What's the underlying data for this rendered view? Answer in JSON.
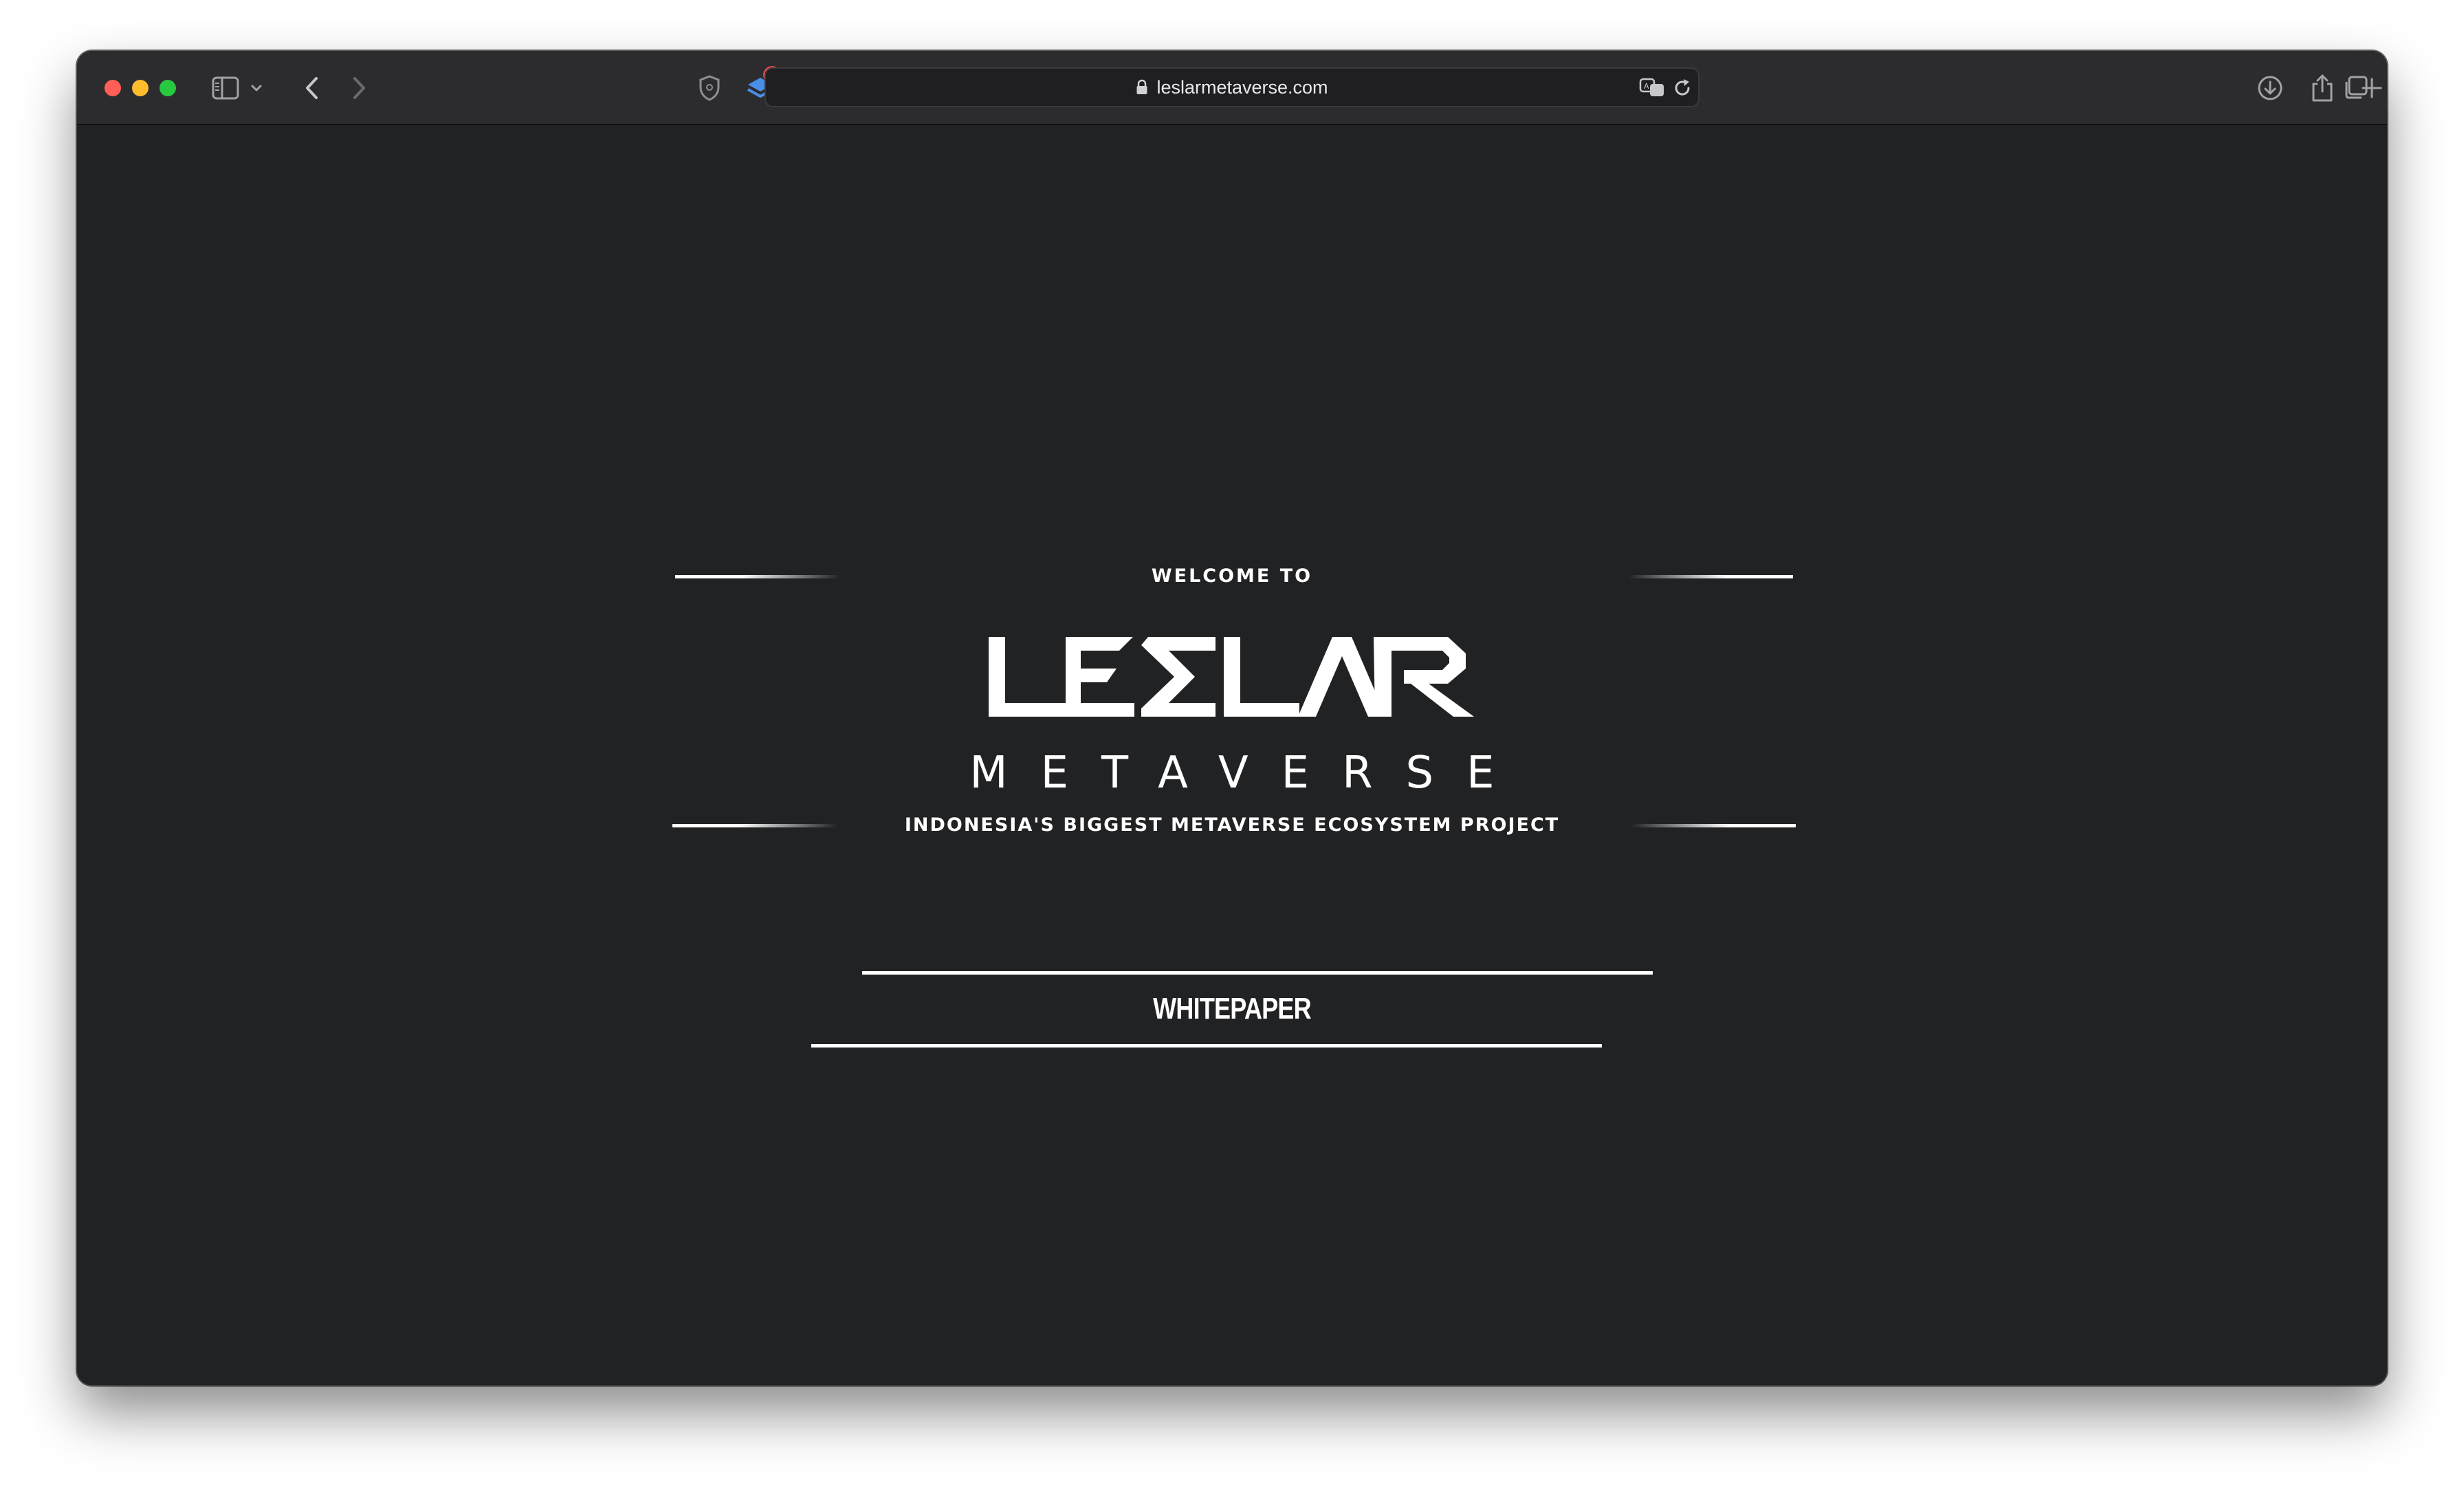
{
  "browser": {
    "url": "leslarmetaverse.com",
    "extension_badge_count": "1"
  },
  "hero": {
    "welcome_text": "WELCOME TO",
    "logo_wordmark": "LESLAR",
    "logo_subtitle": "METAVERSE",
    "tagline": "INDONESIA'S BIGGEST METAVERSE ECOSYSTEM PROJECT",
    "whitepaper_label": "WHITEPAPER"
  },
  "colors": {
    "page_background": "#212224",
    "text": "#ffffff",
    "toolbar": "#2c2c2e"
  }
}
